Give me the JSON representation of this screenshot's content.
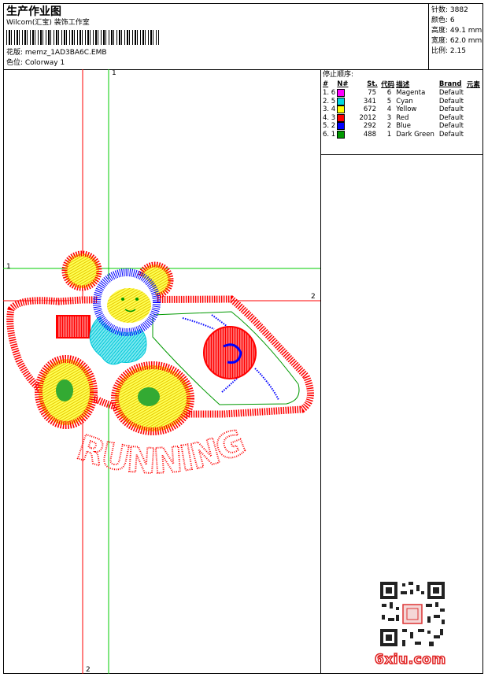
{
  "header": {
    "title": "生产作业图",
    "company": "Wilcom(汇宝) 装饰工作室",
    "design_label": "花版: memz_1AD3BA6C.EMB",
    "colorway_label": "色位: Colorway 1"
  },
  "stats": {
    "stitches": "针数: 3882",
    "colors": "颜色: 6",
    "height": "高度: 49.1 mm",
    "width": "宽度: 62.0 mm",
    "scale": "比例: 2.15"
  },
  "stop_sequence": {
    "title": "停止顺序:",
    "headers": [
      "#",
      "N#",
      "St.",
      "代码",
      "描述",
      "Brand",
      "元素"
    ],
    "rows": [
      {
        "num": "1. 6",
        "stitches": "75",
        "code": "6",
        "desc": "Magenta",
        "brand": "Default",
        "color": "#ff00ff"
      },
      {
        "num": "2. 5",
        "stitches": "341",
        "code": "5",
        "desc": "Cyan",
        "brand": "Default",
        "color": "#00d8e0"
      },
      {
        "num": "3. 4",
        "stitches": "672",
        "code": "4",
        "desc": "Yellow",
        "brand": "Default",
        "color": "#ffff00"
      },
      {
        "num": "4. 3",
        "stitches": "2012",
        "code": "3",
        "desc": "Red",
        "brand": "Default",
        "color": "#ff0000"
      },
      {
        "num": "5. 2",
        "stitches": "292",
        "code": "2",
        "desc": "Blue",
        "brand": "Default",
        "color": "#0000ff"
      },
      {
        "num": "6. 1",
        "stitches": "488",
        "code": "1",
        "desc": "Dark Green",
        "brand": "Default",
        "color": "#009900"
      }
    ]
  },
  "guides": {
    "green_v": "1",
    "green_h": "1",
    "red_h": "2",
    "red_v": "2"
  },
  "artwork": {
    "text": "RUNNING"
  },
  "watermark": {
    "text": "6xiu.com"
  }
}
